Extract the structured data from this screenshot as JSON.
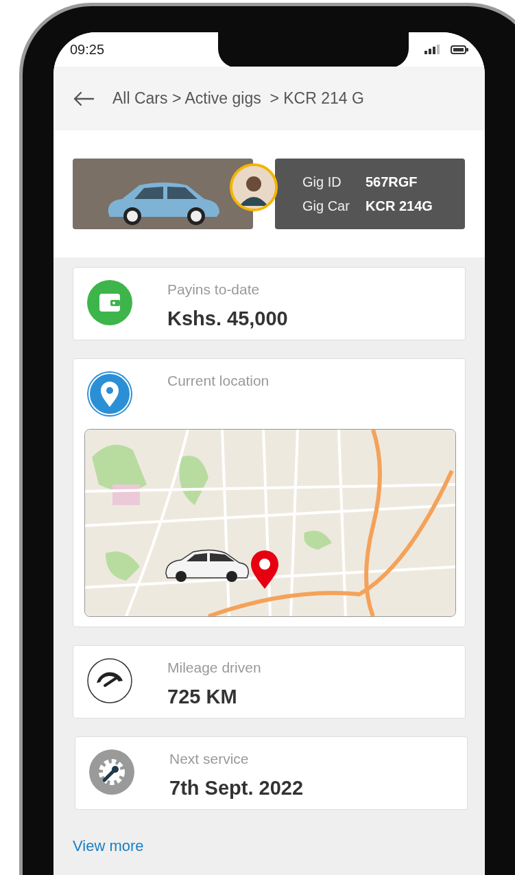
{
  "status_bar": {
    "time": "09:25"
  },
  "header": {
    "breadcrumb": "All Cars > Active gigs  > KCR 214 G"
  },
  "gig": {
    "fields": [
      {
        "label": "Gig ID",
        "value": "567RGF"
      },
      {
        "label": "Gig Car",
        "value": "KCR 214G"
      }
    ]
  },
  "cards": [
    {
      "kind": "payins",
      "label": "Payins to-date",
      "value": "Kshs. 45,000"
    },
    {
      "kind": "location",
      "label": "Current location"
    },
    {
      "kind": "mileage",
      "label": "Mileage driven",
      "value": "725 KM"
    },
    {
      "kind": "service",
      "label": "Next service",
      "value": "7th Sept. 2022"
    }
  ],
  "link": "View more"
}
